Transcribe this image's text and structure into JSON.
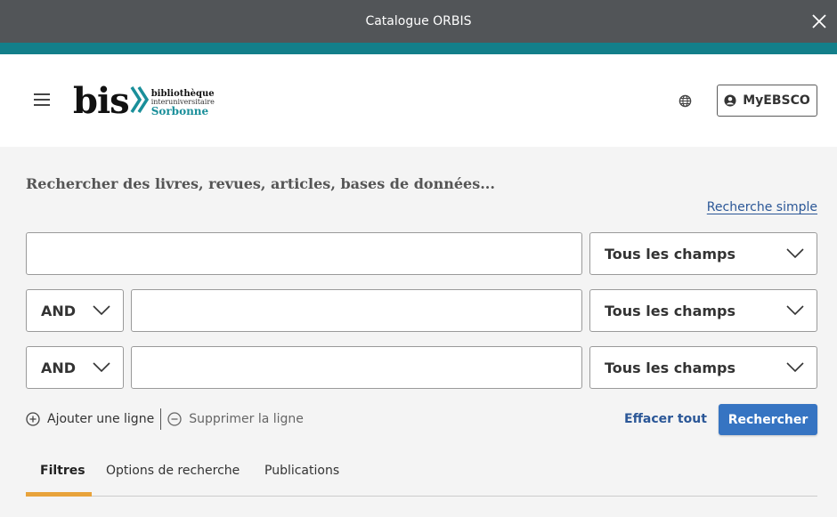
{
  "window": {
    "title": "Catalogue ORBIS"
  },
  "header": {
    "logo": {
      "word": "bis",
      "line1": "bibliothèque",
      "line2": "interuniversitaire",
      "line3": "Sorbonne"
    },
    "account_label": "MyEBSCO"
  },
  "search": {
    "prompt": "Rechercher des livres, revues, articles, bases de données...",
    "simple_link": "Recherche simple",
    "rows": [
      {
        "query": "",
        "field": "Tous les champs"
      },
      {
        "operator": "AND",
        "query": "",
        "field": "Tous les champs"
      },
      {
        "operator": "AND",
        "query": "",
        "field": "Tous les champs"
      }
    ],
    "add_line": "Ajouter une ligne",
    "remove_line": "Supprimer la ligne",
    "clear_all": "Effacer tout",
    "submit": "Rechercher"
  },
  "tabs": [
    {
      "label": "Filtres",
      "active": true
    },
    {
      "label": "Options de recherche",
      "active": false
    },
    {
      "label": "Publications",
      "active": false
    }
  ],
  "colors": {
    "teal": "#137f8a",
    "primary_blue": "#3674c2",
    "link_blue": "#2b5797",
    "tab_accent": "#e8a33b"
  },
  "icons": [
    "close-icon",
    "menu-icon",
    "globe-icon",
    "user-icon",
    "chevron-down-icon",
    "plus-circle-icon",
    "minus-circle-icon"
  ]
}
